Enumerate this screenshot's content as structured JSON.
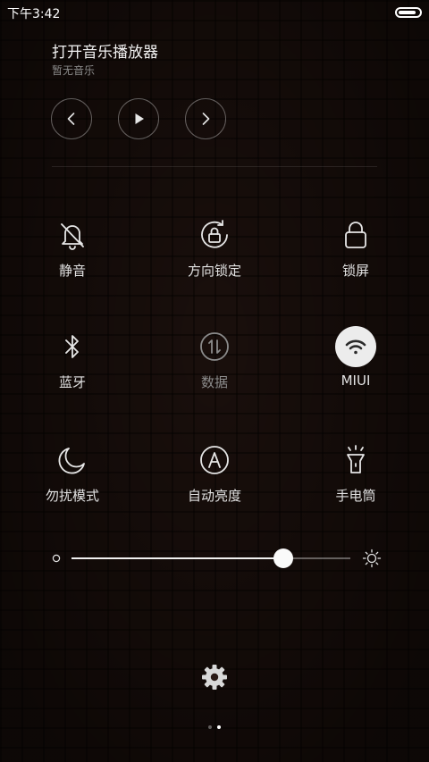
{
  "status_bar": {
    "time": "下午3:42",
    "battery_level": 0.9
  },
  "music": {
    "title": "打开音乐播放器",
    "subtitle": "暂无音乐",
    "controls": [
      "previous-icon",
      "play-icon",
      "next-icon"
    ]
  },
  "toggles": [
    {
      "label": "静音",
      "icon": "bell-off-icon",
      "state": "off"
    },
    {
      "label": "方向锁定",
      "icon": "rotation-lock-icon",
      "state": "off"
    },
    {
      "label": "锁屏",
      "icon": "lock-icon",
      "state": "off"
    },
    {
      "label": "蓝牙",
      "icon": "bluetooth-icon",
      "state": "off"
    },
    {
      "label": "数据",
      "icon": "mobile-data-icon",
      "state": "disabled"
    },
    {
      "label": "MIUI",
      "icon": "wifi-icon",
      "state": "on"
    },
    {
      "label": "勿扰模式",
      "icon": "moon-icon",
      "state": "off"
    },
    {
      "label": "自动亮度",
      "icon": "auto-brightness-icon",
      "state": "off"
    },
    {
      "label": "手电筒",
      "icon": "flashlight-icon",
      "state": "off"
    }
  ],
  "brightness": {
    "level": 0.76
  },
  "page_indicator": {
    "count": 2,
    "active": 1
  },
  "colors": {
    "active_toggle_bg": "#ececec",
    "icon": "#e6e6e6",
    "dim": "#8b8b8b"
  }
}
